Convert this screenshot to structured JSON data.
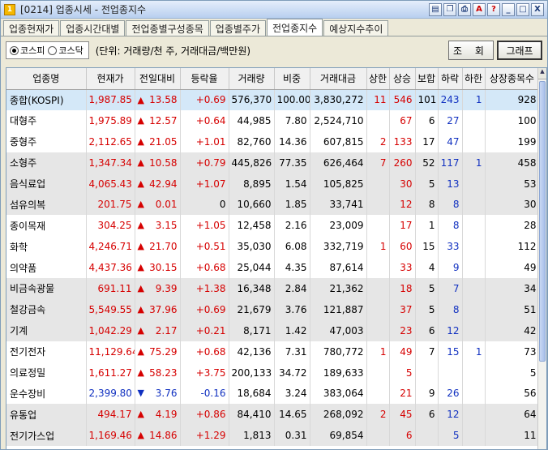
{
  "window": {
    "title": "[0214] 업종시세 - 전업종지수",
    "icon": "1",
    "buttons": [
      "icon-a",
      "icon-b",
      "icon-c",
      "A",
      "?",
      "_",
      "□",
      "X"
    ]
  },
  "tabs": [
    {
      "label": "업종현재가",
      "active": false
    },
    {
      "label": "업종시간대별",
      "active": false
    },
    {
      "label": "전업종별구성종목",
      "active": false
    },
    {
      "label": "업종별주가",
      "active": false
    },
    {
      "label": "전업종지수",
      "active": true
    },
    {
      "label": "예상지수추이",
      "active": false
    }
  ],
  "toolbar": {
    "radio_kospi": "코스피",
    "radio_kosdaq": "코스닥",
    "unit_text": "(단위: 거래량/천 주, 거래대금/백만원)",
    "query_label": "조 회",
    "graph_label": "그래프"
  },
  "table": {
    "headers": [
      "업종명",
      "현재가",
      "전일대비",
      "등락율",
      "거래량",
      "비중",
      "거래대금",
      "상한",
      "상승",
      "보합",
      "하락",
      "하한",
      "상장종목수"
    ],
    "rows": [
      {
        "name": "종합(KOSPI)",
        "price": "1,987.85",
        "dir": "up",
        "chg": "13.58",
        "rate": "+0.69",
        "vol": "576,370",
        "weight": "100.00",
        "amt": "3,830,272",
        "upper": "11",
        "rise": "546",
        "flat": "101",
        "fall": "243",
        "lower": "1",
        "listed": "928"
      },
      {
        "name": "대형주",
        "price": "1,975.89",
        "dir": "up",
        "chg": "12.57",
        "rate": "+0.64",
        "vol": "44,985",
        "weight": "7.80",
        "amt": "2,524,710",
        "upper": "",
        "rise": "67",
        "flat": "6",
        "fall": "27",
        "lower": "",
        "listed": "100"
      },
      {
        "name": "중형주",
        "price": "2,112.65",
        "dir": "up",
        "chg": "21.05",
        "rate": "+1.01",
        "vol": "82,760",
        "weight": "14.36",
        "amt": "607,815",
        "upper": "2",
        "rise": "133",
        "flat": "17",
        "fall": "47",
        "lower": "",
        "listed": "199"
      },
      {
        "name": "소형주",
        "price": "1,347.34",
        "dir": "up",
        "chg": "10.58",
        "rate": "+0.79",
        "vol": "445,826",
        "weight": "77.35",
        "amt": "626,464",
        "upper": "7",
        "rise": "260",
        "flat": "52",
        "fall": "117",
        "lower": "1",
        "listed": "458"
      },
      {
        "name": "음식료업",
        "price": "4,065.43",
        "dir": "up",
        "chg": "42.94",
        "rate": "+1.07",
        "vol": "8,895",
        "weight": "1.54",
        "amt": "105,825",
        "upper": "",
        "rise": "30",
        "flat": "5",
        "fall": "13",
        "lower": "",
        "listed": "53"
      },
      {
        "name": "섬유의복",
        "price": "201.75",
        "dir": "up",
        "chg": "0.01",
        "rate": "0",
        "vol": "10,660",
        "weight": "1.85",
        "amt": "33,741",
        "upper": "",
        "rise": "12",
        "flat": "8",
        "fall": "8",
        "lower": "",
        "listed": "30"
      },
      {
        "name": "종이목재",
        "price": "304.25",
        "dir": "up",
        "chg": "3.15",
        "rate": "+1.05",
        "vol": "12,458",
        "weight": "2.16",
        "amt": "23,009",
        "upper": "",
        "rise": "17",
        "flat": "1",
        "fall": "8",
        "lower": "",
        "listed": "28"
      },
      {
        "name": "화학",
        "price": "4,246.71",
        "dir": "up",
        "chg": "21.70",
        "rate": "+0.51",
        "vol": "35,030",
        "weight": "6.08",
        "amt": "332,719",
        "upper": "1",
        "rise": "60",
        "flat": "15",
        "fall": "33",
        "lower": "",
        "listed": "112"
      },
      {
        "name": "의약품",
        "price": "4,437.36",
        "dir": "up",
        "chg": "30.15",
        "rate": "+0.68",
        "vol": "25,044",
        "weight": "4.35",
        "amt": "87,614",
        "upper": "",
        "rise": "33",
        "flat": "4",
        "fall": "9",
        "lower": "",
        "listed": "49"
      },
      {
        "name": "비금속광물",
        "price": "691.11",
        "dir": "up",
        "chg": "9.39",
        "rate": "+1.38",
        "vol": "16,348",
        "weight": "2.84",
        "amt": "21,362",
        "upper": "",
        "rise": "18",
        "flat": "5",
        "fall": "7",
        "lower": "",
        "listed": "34"
      },
      {
        "name": "철강금속",
        "price": "5,549.55",
        "dir": "up",
        "chg": "37.96",
        "rate": "+0.69",
        "vol": "21,679",
        "weight": "3.76",
        "amt": "121,887",
        "upper": "",
        "rise": "37",
        "flat": "5",
        "fall": "8",
        "lower": "",
        "listed": "51"
      },
      {
        "name": "기계",
        "price": "1,042.29",
        "dir": "up",
        "chg": "2.17",
        "rate": "+0.21",
        "vol": "8,171",
        "weight": "1.42",
        "amt": "47,003",
        "upper": "",
        "rise": "23",
        "flat": "6",
        "fall": "12",
        "lower": "",
        "listed": "42"
      },
      {
        "name": "전기전자",
        "price": "11,129.64",
        "dir": "up",
        "chg": "75.29",
        "rate": "+0.68",
        "vol": "42,136",
        "weight": "7.31",
        "amt": "780,772",
        "upper": "1",
        "rise": "49",
        "flat": "7",
        "fall": "15",
        "lower": "1",
        "listed": "73"
      },
      {
        "name": "의료정밀",
        "price": "1,611.27",
        "dir": "up",
        "chg": "58.23",
        "rate": "+3.75",
        "vol": "200,133",
        "weight": "34.72",
        "amt": "189,633",
        "upper": "",
        "rise": "5",
        "flat": "",
        "fall": "",
        "lower": "",
        "listed": "5"
      },
      {
        "name": "운수장비",
        "price": "2,399.80",
        "dir": "down",
        "chg": "3.76",
        "rate": "-0.16",
        "vol": "18,684",
        "weight": "3.24",
        "amt": "383,064",
        "upper": "",
        "rise": "21",
        "flat": "9",
        "fall": "26",
        "lower": "",
        "listed": "56"
      },
      {
        "name": "유통업",
        "price": "494.17",
        "dir": "up",
        "chg": "4.19",
        "rate": "+0.86",
        "vol": "84,410",
        "weight": "14.65",
        "amt": "268,092",
        "upper": "2",
        "rise": "45",
        "flat": "6",
        "fall": "12",
        "lower": "",
        "listed": "64"
      },
      {
        "name": "전기가스업",
        "price": "1,169.46",
        "dir": "up",
        "chg": "14.86",
        "rate": "+1.29",
        "vol": "1,813",
        "weight": "0.31",
        "amt": "69,854",
        "upper": "",
        "rise": "6",
        "flat": "",
        "fall": "5",
        "lower": "",
        "listed": "11"
      }
    ]
  },
  "colors": {
    "up": "#D60000",
    "down": "#1030C0",
    "selected_row": "#D4E8F8",
    "band_row": "#E6E6E6"
  }
}
